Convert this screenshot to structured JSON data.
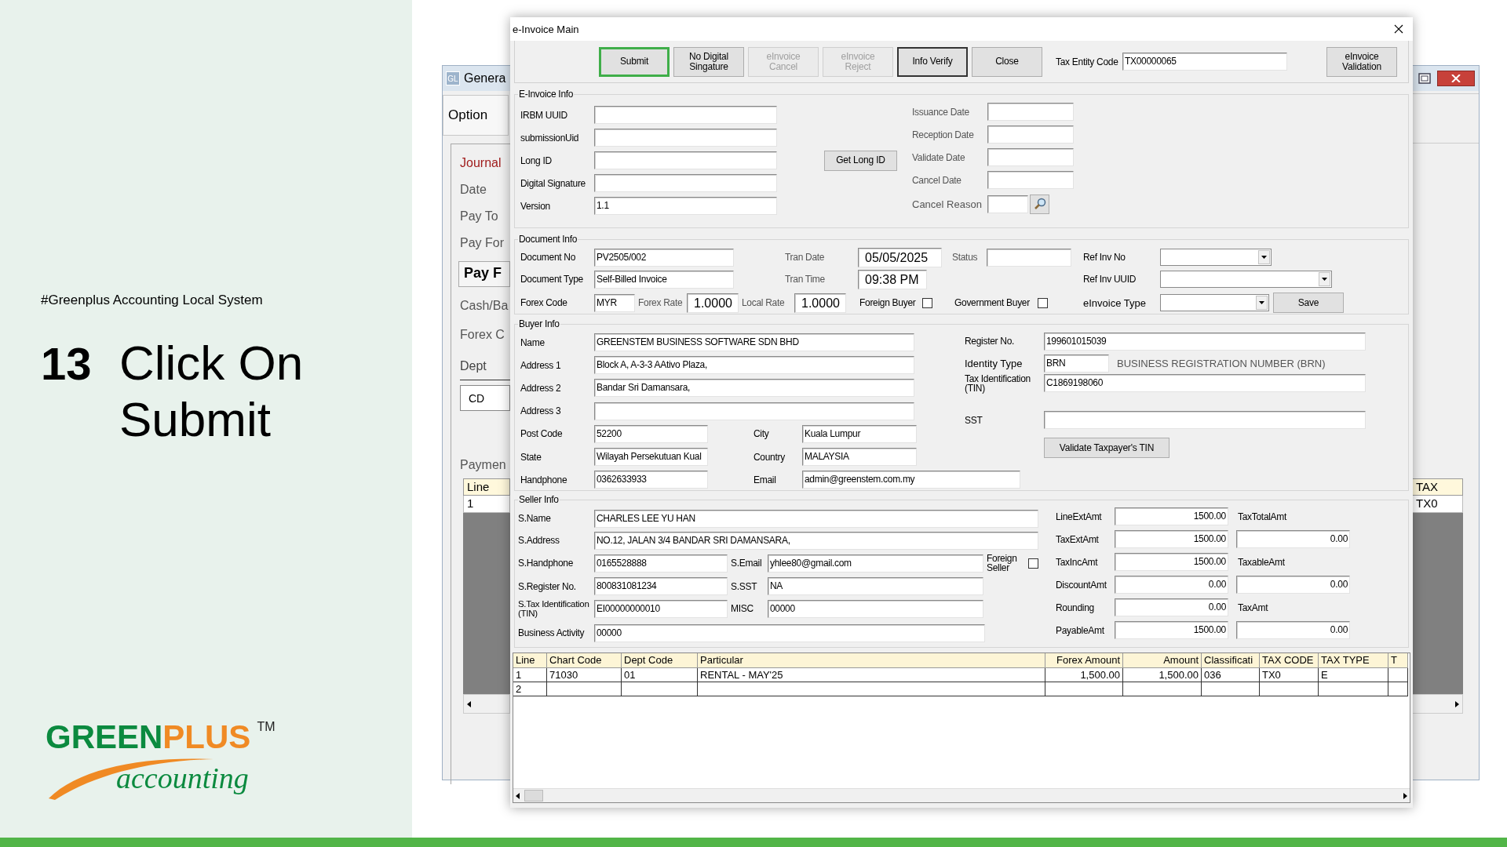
{
  "slide": {
    "tagline": "#Greenplus Accounting Local System",
    "step_number": "13",
    "step_title": "Click On Submit",
    "logo": {
      "green_part": "GREEN",
      "orange_part": "PLUS",
      "trademark": "TM",
      "subtitle": "accounting"
    }
  },
  "background_window": {
    "app_icon": "GL",
    "title": "Genera",
    "tab": "Option",
    "labels": [
      {
        "text": "Journal",
        "kind": "heading"
      },
      {
        "text": "Date",
        "kind": "label"
      },
      {
        "text": "Pay To",
        "kind": "label"
      },
      {
        "text": "Pay For",
        "kind": "label"
      },
      {
        "text": "Pay F",
        "kind": "button"
      },
      {
        "text": "Cash/Ba",
        "kind": "label"
      },
      {
        "text": "Forex C",
        "kind": "label"
      },
      {
        "text": "Dept",
        "kind": "underlined"
      },
      {
        "text": "CD",
        "kind": "field"
      },
      {
        "text": "Paymen",
        "kind": "label"
      }
    ],
    "left_grid": {
      "header": "Line",
      "cell": "1"
    },
    "right_grid": {
      "header": "TAX",
      "cell": "TX0"
    }
  },
  "dialog": {
    "title": "e-Invoice Main",
    "toolbar": [
      {
        "label": "Submit",
        "highlighted": true,
        "default": false,
        "disabled": false
      },
      {
        "label": "No Digital Singature",
        "highlighted": false,
        "default": false,
        "disabled": false
      },
      {
        "label": "eInvoice Cancel",
        "highlighted": false,
        "default": false,
        "disabled": true
      },
      {
        "label": "eInvoice Reject",
        "highlighted": false,
        "default": false,
        "disabled": true
      },
      {
        "label": "Info Verify",
        "highlighted": false,
        "default": true,
        "disabled": false
      },
      {
        "label": "Close",
        "highlighted": false,
        "default": false,
        "disabled": false
      }
    ],
    "tax_entity_code": {
      "label": "Tax Entity Code",
      "value": "TX00000065"
    },
    "validation_button": "eInvoice Validation",
    "einvoice_info": {
      "title": "E-Invoice Info",
      "fields": [
        {
          "label": "IRBM UUID"
        },
        {
          "label": "submissionUid"
        },
        {
          "label": "Long ID"
        },
        {
          "label": "Digital Signature"
        },
        {
          "label": "Version",
          "value": "1.1"
        }
      ],
      "get_long_id_button": "Get Long ID",
      "dates": [
        {
          "label": "Issuance Date"
        },
        {
          "label": "Reception Date"
        },
        {
          "label": "Validate Date"
        },
        {
          "label": "Cancel Date"
        }
      ],
      "cancel_reason": {
        "label": "Cancel Reason"
      }
    },
    "document_info": {
      "title": "Document Info",
      "document_no": {
        "label": "Document No",
        "value": "PV2505/002"
      },
      "document_type": {
        "label": "Document Type",
        "value": "Self-Billed Invoice"
      },
      "tran_date": {
        "label": "Tran Date",
        "value": "05/05/2025"
      },
      "tran_time": {
        "label": "Tran Time",
        "value": "09:38 PM"
      },
      "status": {
        "label": "Status"
      },
      "ref_inv_no": {
        "label": "Ref Inv No"
      },
      "ref_inv_uuid": {
        "label": "Ref Inv UUID"
      },
      "forex_code": {
        "label": "Forex Code",
        "value": "MYR"
      },
      "forex_rate": {
        "label": "Forex Rate",
        "value": "1.0000"
      },
      "local_rate": {
        "label": "Local Rate",
        "value": "1.0000"
      },
      "foreign_buyer": {
        "label": "Foreign Buyer",
        "checked": false
      },
      "government_buyer": {
        "label": "Government Buyer",
        "checked": false
      },
      "einvoice_type": {
        "label": "eInvoice Type"
      },
      "save_button": "Save"
    },
    "buyer_info": {
      "title": "Buyer Info",
      "name": {
        "label": "Name",
        "value": "GREENSTEM BUSINESS SOFTWARE SDN BHD"
      },
      "address_1": {
        "label": "Address 1",
        "value": "Block A, A-3-3 AAtivo Plaza,"
      },
      "address_2": {
        "label": "Address 2",
        "value": "Bandar Sri Damansara,"
      },
      "address_3": {
        "label": "Address 3"
      },
      "post_code": {
        "label": "Post Code",
        "value": "52200"
      },
      "city": {
        "label": "City",
        "value": "Kuala Lumpur"
      },
      "state": {
        "label": "State",
        "value": "Wilayah Persekutuan Kual"
      },
      "country": {
        "label": "Country",
        "value": "MALAYSIA"
      },
      "handphone": {
        "label": "Handphone",
        "value": "0362633933"
      },
      "email": {
        "label": "Email",
        "value": "admin@greenstem.com.my"
      },
      "register_no": {
        "label": "Register No.",
        "value": "199601015039"
      },
      "identity_type": {
        "label": "Identity Type",
        "value": "BRN",
        "description": "BUSINESS REGISTRATION NUMBER (BRN)"
      },
      "tax_identification": {
        "label": "Tax Identification (TIN)",
        "value": "C1869198060"
      },
      "sst": {
        "label": "SST"
      },
      "validate_button": "Validate Taxpayer's TIN"
    },
    "seller_info": {
      "title": "Seller Info",
      "name": {
        "label": "S.Name",
        "value": "CHARLES LEE YU HAN"
      },
      "address": {
        "label": "S.Address",
        "value": "NO.12, JALAN 3/4 BANDAR SRI DAMANSARA,"
      },
      "handphone": {
        "label": "S.Handphone",
        "value": "0165528888"
      },
      "email": {
        "label": "S.Email",
        "value": "yhlee80@gmail.com"
      },
      "foreign_seller": {
        "label": "Foreign Seller",
        "checked": false
      },
      "register_no": {
        "label": "S.Register No.",
        "value": "800831081234"
      },
      "sst": {
        "label": "S.SST",
        "value": "NA"
      },
      "tax_identification": {
        "label": "S.Tax Identification (TIN)",
        "value": "EI00000000010"
      },
      "misc": {
        "label": "MISC",
        "value": "00000"
      },
      "business_activity": {
        "label": "Business Activity",
        "value": "00000"
      }
    },
    "amounts": [
      {
        "label": "LineExtAmt",
        "value": "1500.00"
      },
      {
        "label": "TaxExtAmt",
        "value": "1500.00"
      },
      {
        "label": "TaxIncAmt",
        "value": "1500.00"
      },
      {
        "label": "DiscountAmt",
        "value": "0.00"
      },
      {
        "label": "Rounding",
        "value": "0.00"
      },
      {
        "label": "PayableAmt",
        "value": "1500.00"
      }
    ],
    "tax_amounts": [
      {
        "label": "TaxTotalAmt",
        "value": "0.00"
      },
      {
        "label": "TaxableAmt",
        "value": "0.00"
      },
      {
        "label": "TaxAmt",
        "value": "0.00"
      }
    ],
    "table": {
      "columns": [
        "Line",
        "Chart Code",
        "Dept Code",
        "Particular",
        "Forex Amount",
        "Amount",
        "Classificati",
        "TAX CODE",
        "TAX TYPE",
        "T"
      ],
      "rows": [
        [
          "1",
          "71030",
          "01",
          "RENTAL - MAY'25",
          "1,500.00",
          "1,500.00",
          "036",
          "TX0",
          "E"
        ],
        [
          "2"
        ]
      ]
    }
  }
}
